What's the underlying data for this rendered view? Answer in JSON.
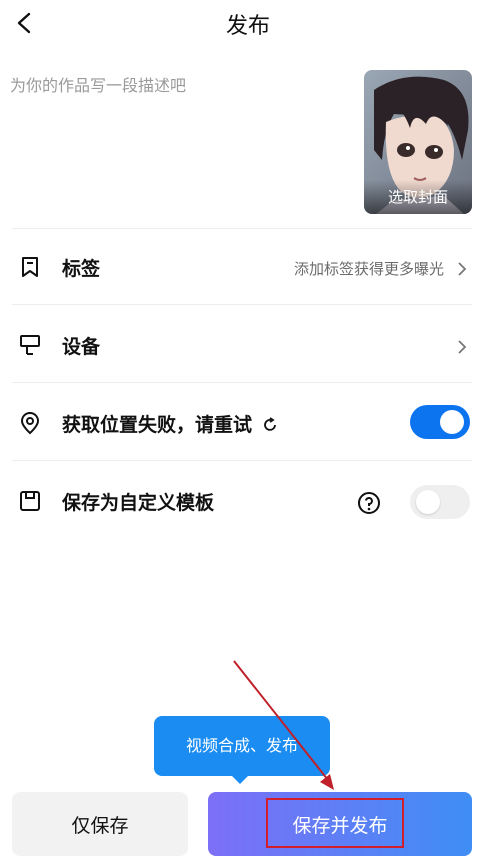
{
  "header": {
    "title": "发布",
    "back_icon": "back-arrow-icon"
  },
  "description": {
    "placeholder": "为你的作品写一段描述吧",
    "value": ""
  },
  "cover": {
    "label": "选取封面"
  },
  "rows": {
    "tags": {
      "label": "标签",
      "hint": "添加标签获得更多曝光",
      "icon": "bookmark-icon"
    },
    "device": {
      "label": "设备",
      "icon": "device-icon"
    },
    "location": {
      "label": "获取位置失败，请重试",
      "icon": "location-pin-icon",
      "toggle_on": true
    },
    "template": {
      "label": "保存为自定义模板",
      "icon": "save-icon",
      "toggle_on": false
    }
  },
  "tooltip": {
    "text": "视频合成、发布"
  },
  "buttons": {
    "save_only": "仅保存",
    "save_publish": "保存并发布"
  },
  "colors": {
    "accent": "#0d74f0",
    "tooltip": "#1a8cf2",
    "gradient_start": "#7d6ff7",
    "gradient_end": "#3f8ef5",
    "annotation": "#d11e2a"
  }
}
